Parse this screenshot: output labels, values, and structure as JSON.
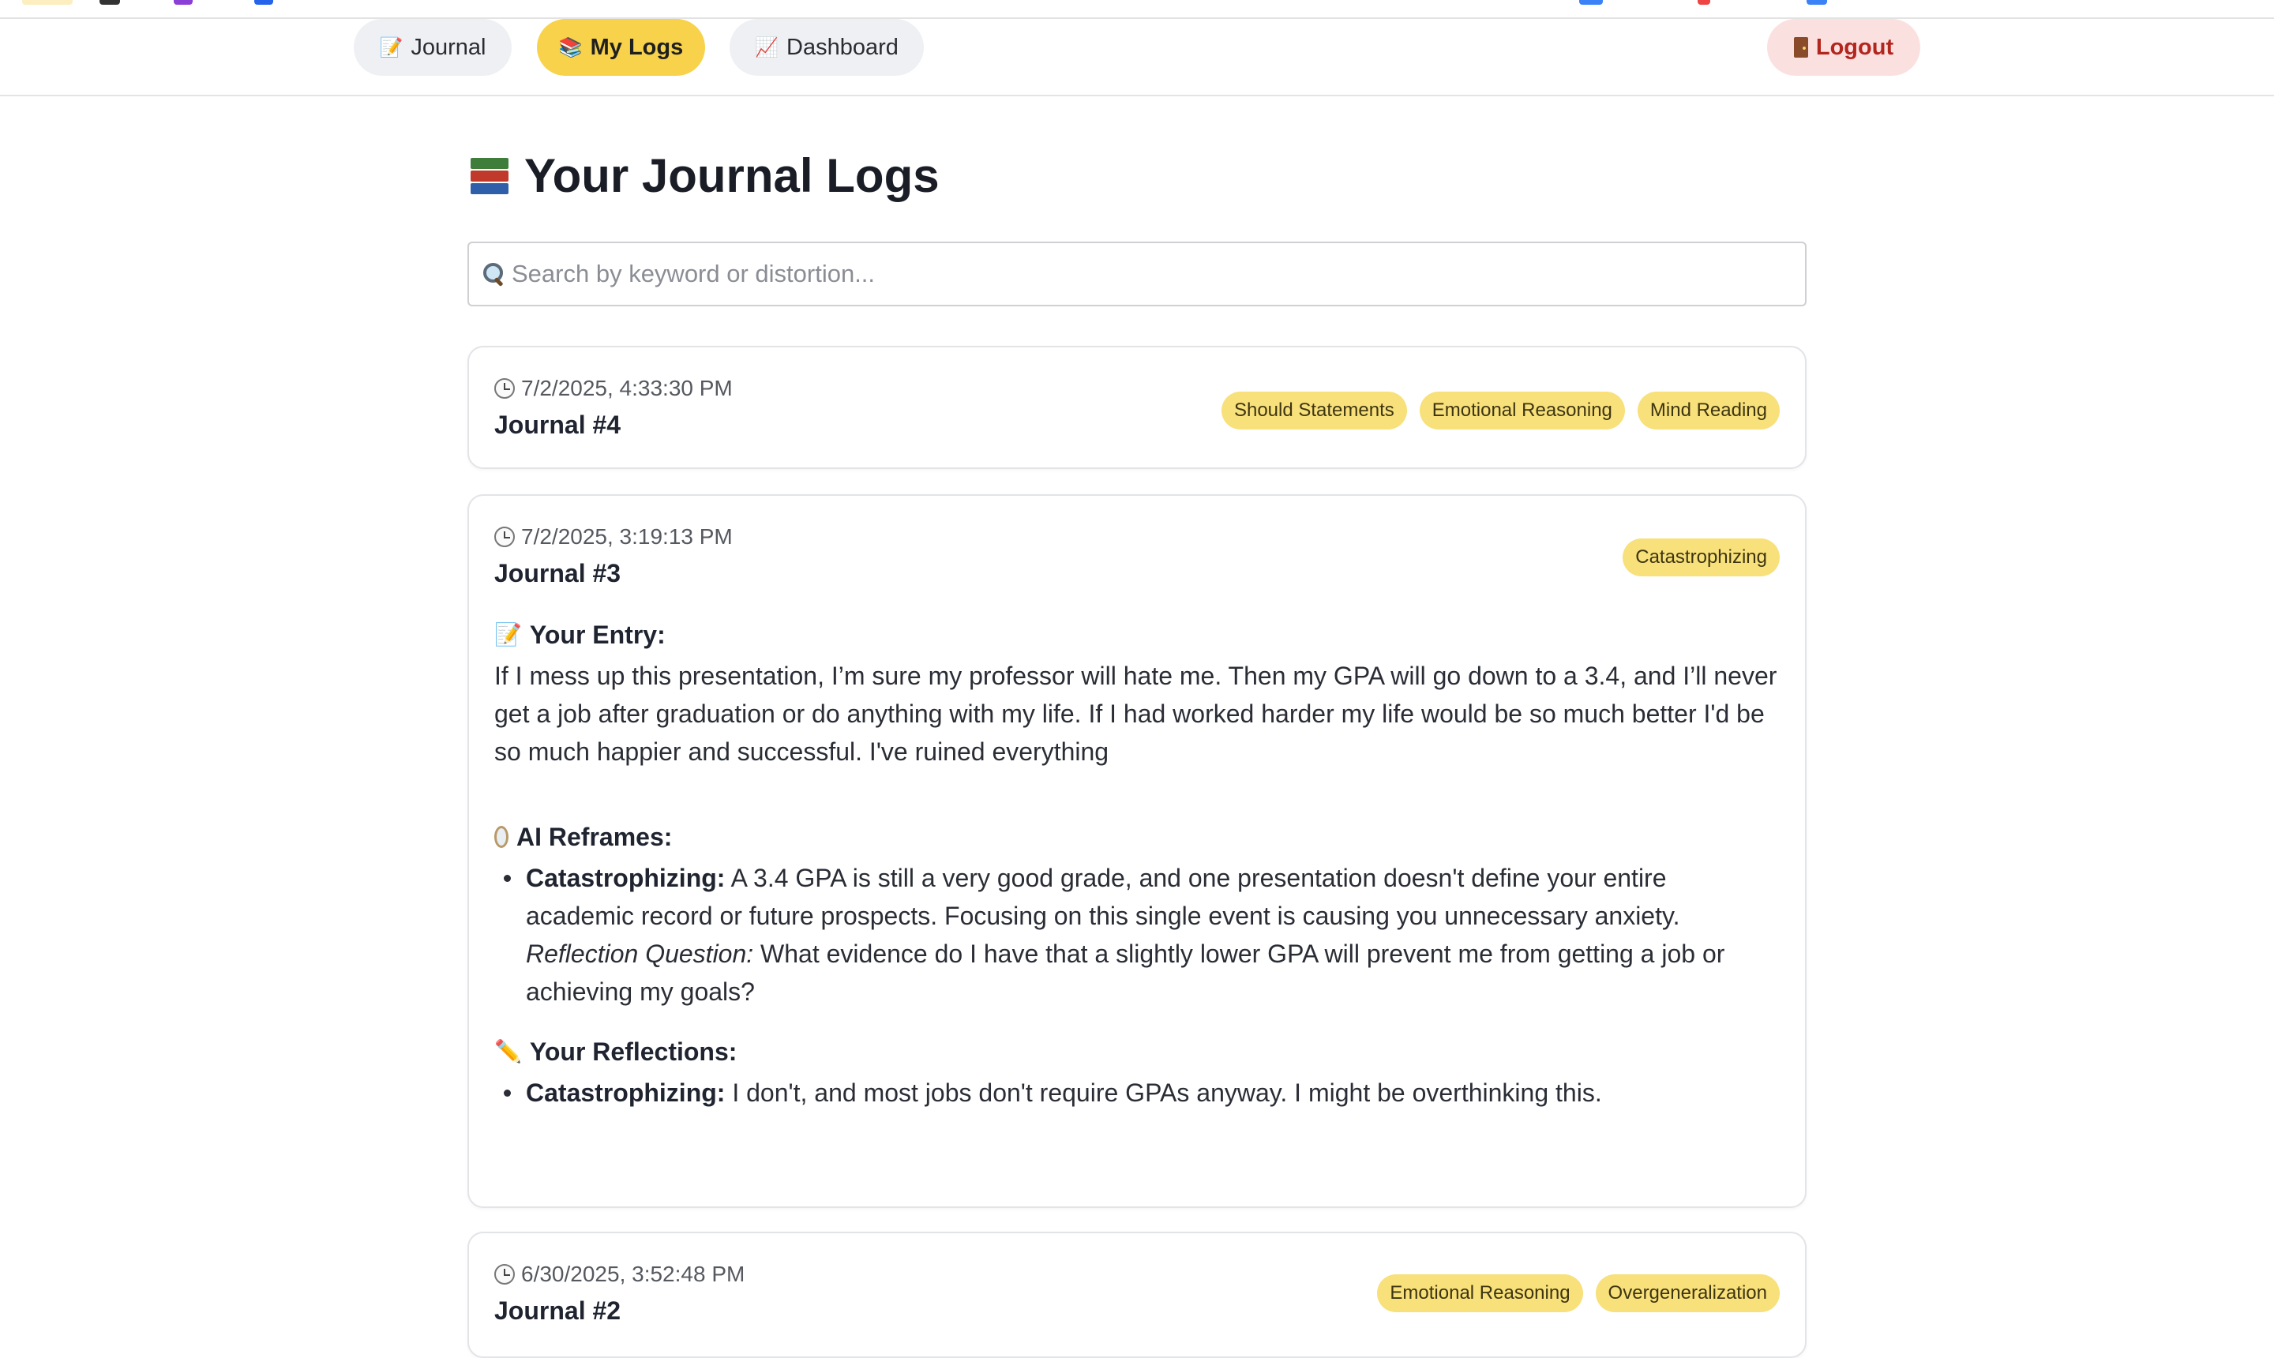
{
  "colors": {
    "accent": "#f7d24a",
    "tag_bg": "#f8e07a",
    "nav_pill_bg": "#eef0f3",
    "logout_bg": "#fbe0e0",
    "logout_text": "#b3261e"
  },
  "nav": {
    "journal": {
      "icon": "📝",
      "label": "Journal"
    },
    "logs": {
      "icon": "📚",
      "label": "My Logs"
    },
    "dashboard": {
      "icon": "📈",
      "label": "Dashboard"
    },
    "logout": {
      "icon": "door-icon",
      "label": "Logout"
    }
  },
  "page": {
    "title": "Your Journal Logs",
    "title_icon": "books-icon"
  },
  "search": {
    "icon": "magnifier-icon",
    "placeholder": "Search by keyword or distortion..."
  },
  "entries": [
    {
      "timestamp": "7/2/2025, 4:33:30 PM",
      "title": "Journal #4",
      "tags": [
        "Should Statements",
        "Emotional Reasoning",
        "Mind Reading"
      ]
    },
    {
      "timestamp": "7/2/2025, 3:19:13 PM",
      "title": "Journal #3",
      "tags": [
        "Catastrophizing"
      ],
      "entry_heading": {
        "icon": "📝",
        "label": "Your Entry:"
      },
      "entry_text": "If I mess up this presentation, I’m sure my professor will hate me. Then my GPA will go down to a 3.4, and I’ll never get a job after graduation or do anything with my life. If I had worked harder my life would be so much better I'd be so much happier and successful. I've ruined everything",
      "reframes_heading": {
        "icon": "mirror-icon",
        "label": "AI Reframes:"
      },
      "reframes": [
        {
          "distortion": "Catastrophizing:",
          "text": "A 3.4 GPA is still a very good grade, and one presentation doesn't define your entire academic record or future prospects. Focusing on this single event is causing you unnecessary anxiety.",
          "question_label": "Reflection Question:",
          "question": "What evidence do I have that a slightly lower GPA will prevent me from getting a job or achieving my goals?"
        }
      ],
      "reflections_heading": {
        "icon": "✏️",
        "label": "Your Reflections:"
      },
      "reflections": [
        {
          "distortion": "Catastrophizing:",
          "text": "I don't, and most jobs don't require GPAs anyway. I might be overthinking this."
        }
      ]
    },
    {
      "timestamp": "6/30/2025, 3:52:48 PM",
      "title": "Journal #2",
      "tags": [
        "Emotional Reasoning",
        "Overgeneralization"
      ]
    }
  ]
}
